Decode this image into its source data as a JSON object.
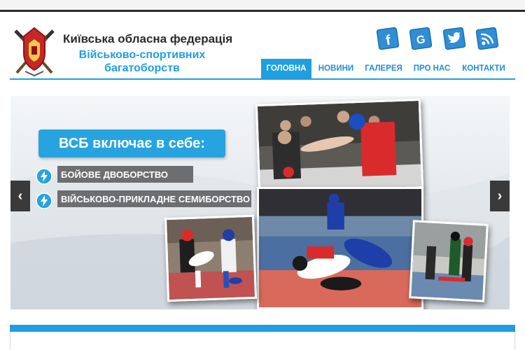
{
  "header": {
    "org_line1": "Київська обласна федерація",
    "org_line2": "Військово-спортивних багатоборств",
    "logo_icon": "federation-emblem-icon"
  },
  "social": [
    {
      "name": "facebook",
      "icon": "facebook-icon",
      "glyph": "f"
    },
    {
      "name": "google",
      "icon": "google-icon",
      "glyph": "G"
    },
    {
      "name": "twitter",
      "icon": "twitter-icon",
      "glyph": ""
    },
    {
      "name": "rss",
      "icon": "rss-icon",
      "glyph": ""
    }
  ],
  "nav": {
    "items": [
      "ГОЛОВНА",
      "НОВИНИ",
      "ГАЛЕРЕЯ",
      "ПРО НАС",
      "КОНТАКТИ"
    ],
    "active_index": 0
  },
  "slider": {
    "title": "ВСБ включає в себе:",
    "items": [
      "БОЙОВЕ ДВОБОРСТВО",
      "ВІЙСЬКОВО-ПРИКЛАДНЕ СЕМИБОРСТВО"
    ],
    "prev_glyph": "‹",
    "next_glyph": "›"
  },
  "colors": {
    "accent": "#1e9fe0",
    "heading_text": "#2b2b2b",
    "label_bg": "#6d6e70",
    "arrow_bg": "#3a3a3a"
  }
}
